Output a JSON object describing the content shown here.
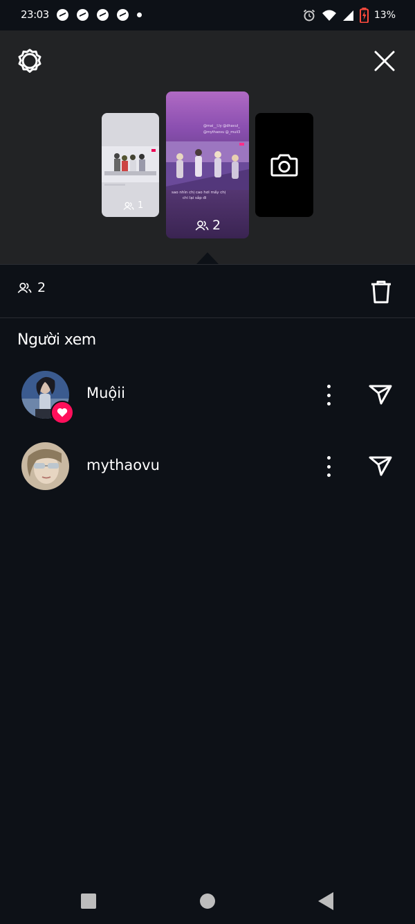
{
  "status_bar": {
    "time": "23:03",
    "battery": "13%",
    "icons": [
      "messenger-icon",
      "messenger-icon",
      "messenger-icon",
      "messenger-icon",
      "alarm-icon",
      "wifi-icon",
      "signal-icon",
      "battery-icon"
    ]
  },
  "stories": [
    {
      "count": "1"
    },
    {
      "count": "2",
      "selected": true,
      "tags": "@mai__l.ly @dhavul_",
      "tags2": "@mythaovu @_muii3",
      "caption": "sao nhìn chị cao hơi mấy chị",
      "caption2": "chi lại sắp đi"
    },
    {
      "type": "camera"
    }
  ],
  "viewers_count": "2",
  "section_title": "Người xem",
  "viewers": [
    {
      "username": "Muộii",
      "liked": true
    },
    {
      "username": "mythaovu",
      "liked": false
    }
  ],
  "colors": {
    "background": "#0d1117",
    "top_panel": "#222325",
    "heart_badge": "#ff0f5b"
  }
}
